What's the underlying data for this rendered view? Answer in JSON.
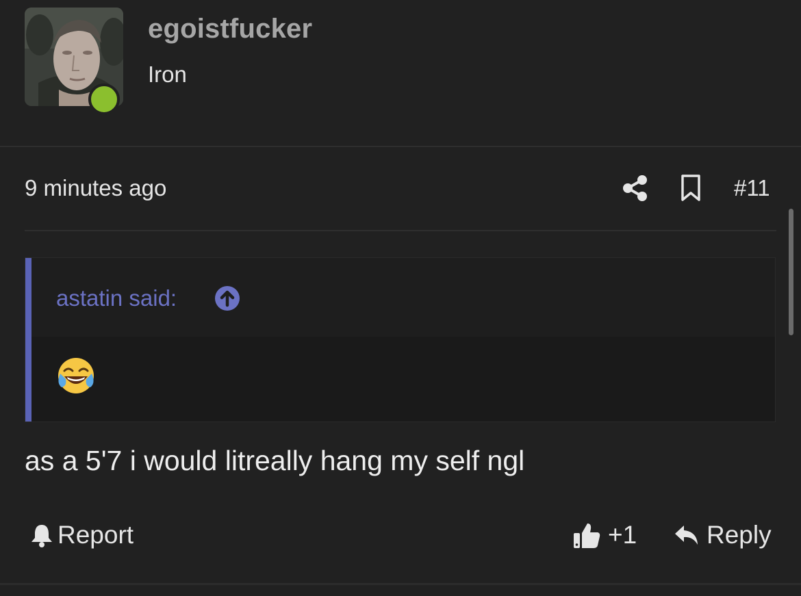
{
  "user": {
    "username": "egoistfucker",
    "title": "Iron",
    "status": "online",
    "status_color": "#8bbf2e"
  },
  "meta": {
    "timestamp": "9 minutes ago",
    "post_number": "#11",
    "icons": [
      "share-icon",
      "bookmark-icon"
    ]
  },
  "quote": {
    "author_label": "astatin said:",
    "jump_icon": "arrow-up-circle-icon",
    "content_emoji": "face-with-tears-of-joy",
    "accent_color": "#5a63b6"
  },
  "post": {
    "text": "as a 5'7 i would litreally hang my self ngl"
  },
  "footer": {
    "report_label": "Report",
    "like_label": "+1",
    "reply_label": "Reply"
  }
}
